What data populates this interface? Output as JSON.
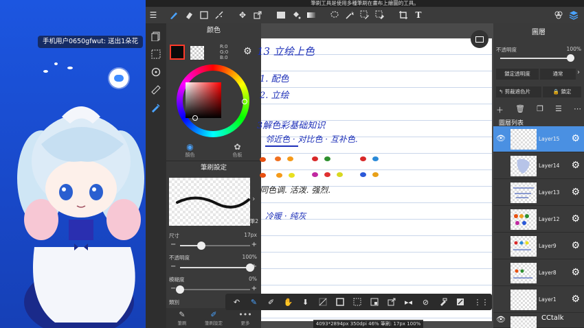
{
  "window": {
    "title": "筆刷工具是使用多種筆刷在畫布上繪圖的工具。"
  },
  "stream": {
    "gift_message": "手机用户0650gfwut: 送出1朵花"
  },
  "icons": {
    "toolbar": [
      "menu-icon",
      "brush-icon",
      "eraser-icon",
      "rect-select-icon",
      "magic-brush-icon",
      "move-icon",
      "transform-icon",
      "fill-color-icon",
      "bucket-icon",
      "gradient-icon",
      "lasso-icon",
      "wand-icon",
      "select-pen-icon",
      "select-eraser-icon",
      "crop-icon",
      "text-icon",
      "materials-icon",
      "layers-icon"
    ],
    "float_bar": [
      "undo-icon",
      "brush-icon",
      "pen-icon",
      "hand-icon",
      "paste-icon",
      "clear-icon",
      "square-icon",
      "dotted-square-icon",
      "dot-square-icon",
      "export-icon",
      "flip-icon",
      "rotate-off-icon",
      "edit-icon",
      "snap-icon",
      "grid-icon"
    ]
  },
  "color_panel": {
    "title": "颜色",
    "r": "R:0",
    "g": "G:0",
    "b": "B:0",
    "tab_color": "顏色",
    "tab_palette": "色板",
    "accent": "#4aa3ff"
  },
  "brush_panel": {
    "title": "筆刷設定",
    "brush_name": "麥克筆2",
    "size_label": "尺寸",
    "size_value": "17px",
    "size_fraction": 0.3,
    "opacity_label": "不透明度",
    "opacity_value": "100%",
    "opacity_fraction": 1.0,
    "blur_label": "模糊度",
    "blur_value": "0%",
    "blur_fraction": 0.0,
    "category_label": "類別",
    "tab_brush": "筆刷",
    "tab_brush_settings": "筆刷設定",
    "tab_more": "更多"
  },
  "canvas": {
    "notes": {
      "heading": "13 立绘上色",
      "item1": "1. 配色",
      "item2": "2. 立绘",
      "section": "3解色彩基础知识",
      "sub": "邻近色 · 对比色 · 互补色.",
      "words": "同色调.    活泼.    强烈.",
      "words2": "冷暖 · 纯灰"
    },
    "status": "4093*2894px 350dpi 46% 筆刷: 17px 100%"
  },
  "layer_panel": {
    "title": "圖層",
    "opacity_label": "不透明度",
    "opacity_value": "100%",
    "lock_opacity": "鎖定透明度",
    "blend_mode": "通常",
    "clipping": "剪裁遮色片",
    "lock": "鎖定",
    "list_title": "圖層列表",
    "layers": [
      "Layer15",
      "Layer14",
      "Layer13",
      "Layer12",
      "Layer9",
      "Layer8",
      "Layer1"
    ],
    "active_color": "#4a90e2"
  },
  "watermark": "CCtalk"
}
